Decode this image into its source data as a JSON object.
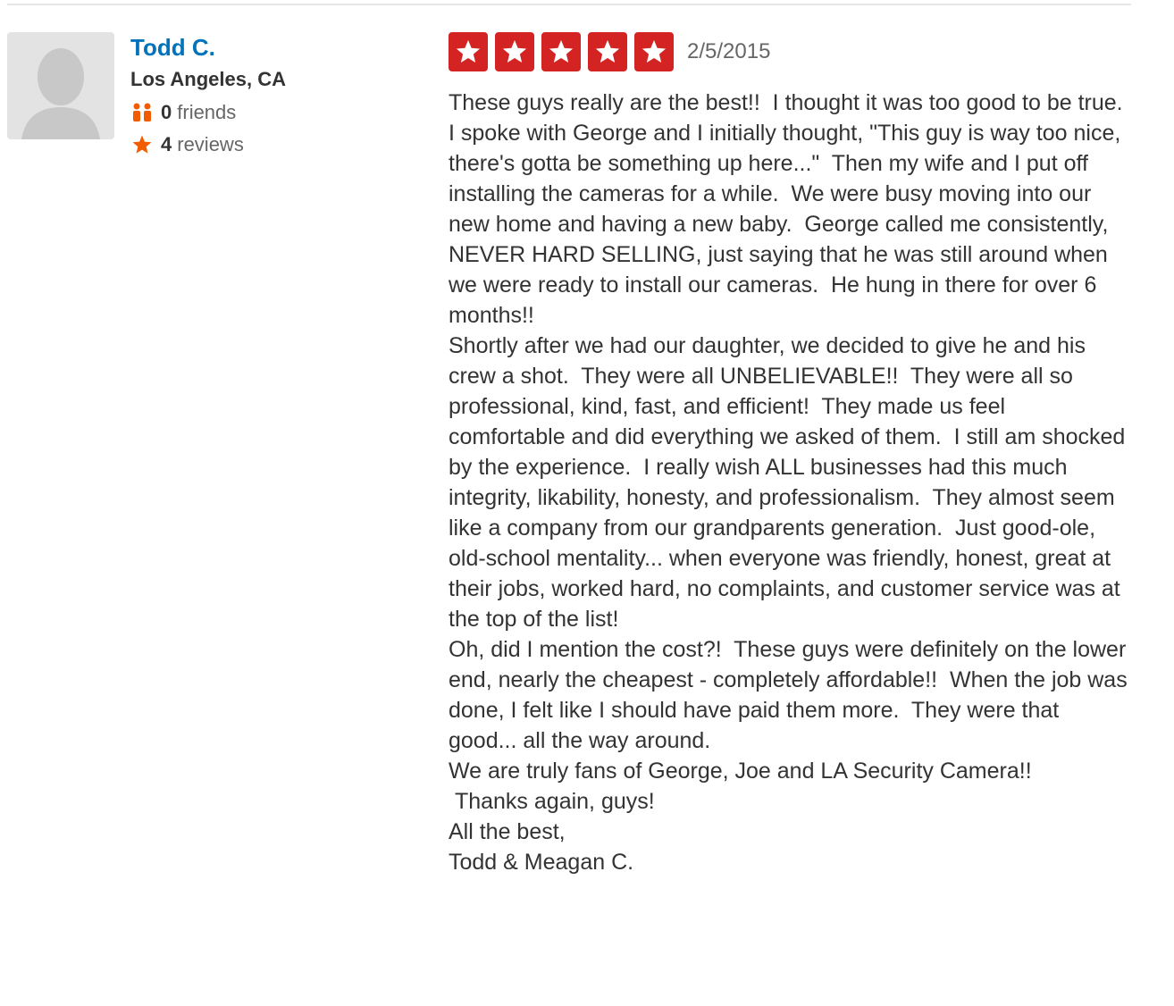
{
  "colors": {
    "star_red": "#d32323",
    "user_link": "#0073bb",
    "text": "#333333",
    "meta_text": "#666666",
    "friends_icon": "#f15c00",
    "reviews_icon": "#f15c00"
  },
  "user": {
    "name": "Todd C.",
    "location": "Los Angeles, CA",
    "friends_count": "0",
    "friends_label": "friends",
    "friends_icon": "friends-icon",
    "reviews_count": "4",
    "reviews_label": "reviews",
    "reviews_icon": "star-icon",
    "avatar": "default-avatar-silhouette"
  },
  "review": {
    "rating": 5,
    "max_rating": 5,
    "date": "2/5/2015",
    "text": "These guys really are the best!!  I thought it was too good to be true.  I spoke with George and I initially thought, \"This guy is way too nice, there's gotta be something up here...\"  Then my wife and I put off installing the cameras for a while.  We were busy moving into our new home and having a new baby.  George called me consistently, NEVER HARD SELLING, just saying that he was still around when we were ready to install our cameras.  He hung in there for over 6 months!!\nShortly after we had our daughter, we decided to give he and his crew a shot.  They were all UNBELIEVABLE!!  They were all so professional, kind, fast, and efficient!  They made us feel comfortable and did everything we asked of them.  I still am shocked by the experience.  I really wish ALL businesses had this much integrity, likability, honesty, and professionalism.  They almost seem like a company from our grandparents generation.  Just good-ole, old-school mentality... when everyone was friendly, honest, great at their jobs, worked hard, no complaints, and customer service was at the top of the list!\nOh, did I mention the cost?!  These guys were definitely on the lower end, nearly the cheapest - completely affordable!!  When the job was done, I felt like I should have paid them more.  They were that good... all the way around.\nWe are truly fans of George, Joe and LA Security Camera!!\n Thanks again, guys!\nAll the best,\nTodd & Meagan C."
  }
}
